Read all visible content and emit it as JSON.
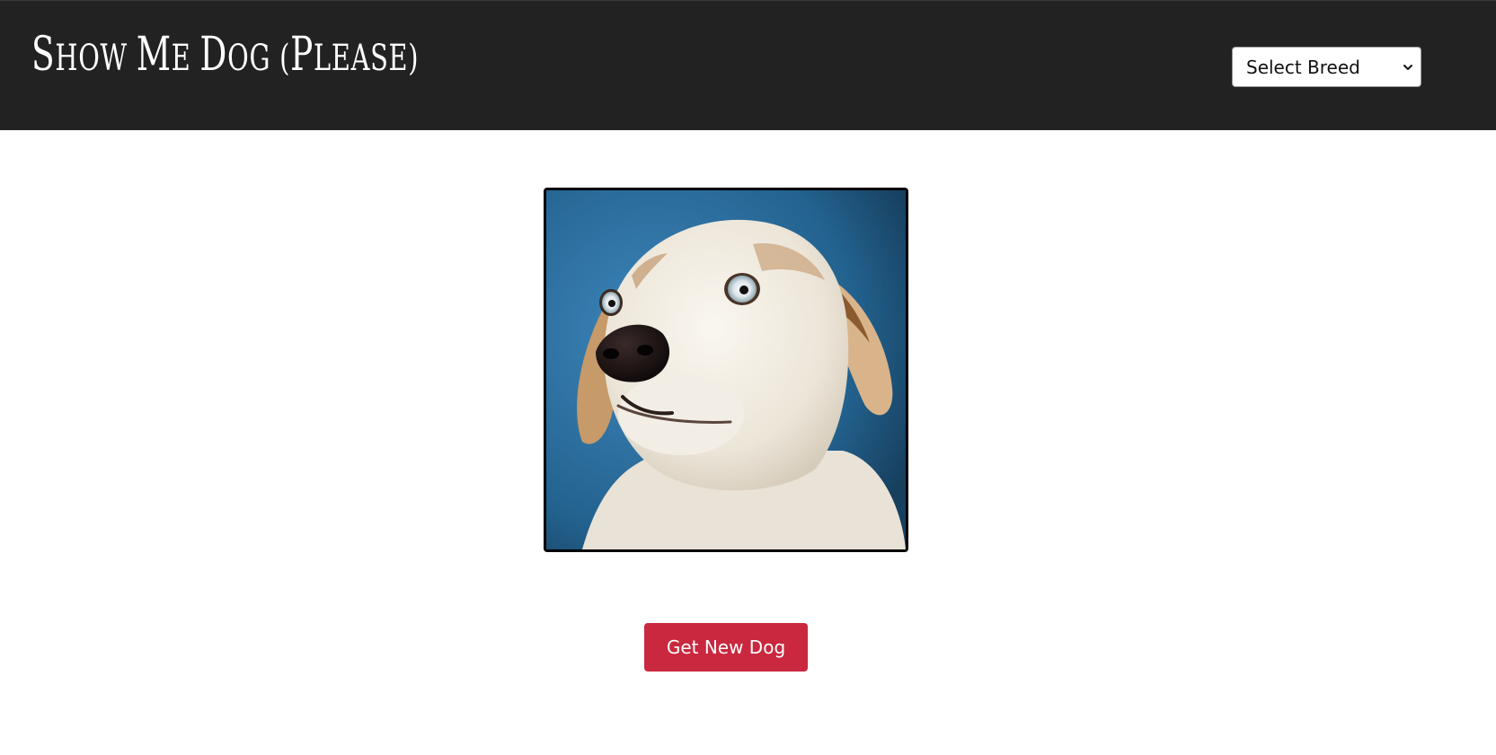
{
  "navbar": {
    "title_first": "S",
    "title_rest": "HOW ",
    "title_m": "M",
    "title_e": "E ",
    "title_d": "D",
    "title_og": "OG (",
    "title_p": "P",
    "title_lease": "LEASE)",
    "breed_select": {
      "selected": "Select Breed",
      "icon": "chevron-down-icon"
    }
  },
  "main": {
    "image_alt": "Dog",
    "button_label": "Get New Dog"
  },
  "colors": {
    "navbar_bg": "#222222",
    "button_bg": "#c9283f",
    "image_bg": "#2e6fa0"
  }
}
